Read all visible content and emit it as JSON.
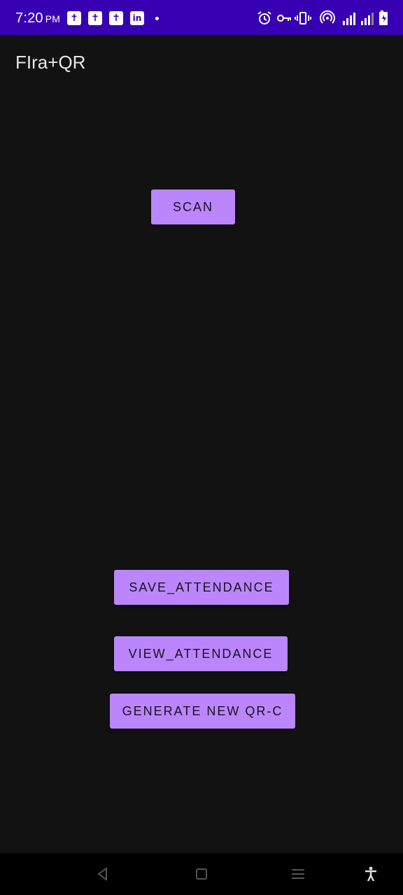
{
  "status_bar": {
    "time": "7:20",
    "ampm": "PM",
    "notification_icons": [
      "bible-app-icon",
      "bible-app-icon",
      "bible-app-icon",
      "linkedin-icon"
    ],
    "system_icons": [
      "alarm-icon",
      "vpn-key-icon",
      "vibrate-icon",
      "hotspot-icon",
      "signal-icon",
      "battery-icon"
    ]
  },
  "app_bar": {
    "title": "FIra+QR"
  },
  "buttons": {
    "scan": "SCAN",
    "save_attendance": "SAVE_ATTENDANCE",
    "view_attendance": "VIEW_ATTENDANCE",
    "generate_qr": "GENERATE NEW QR-C"
  },
  "nav_bar": {
    "items": [
      "back-icon",
      "home-icon",
      "recents-icon",
      "accessibility-icon"
    ]
  },
  "colors": {
    "status_bar": "#3700b3",
    "background": "#121212",
    "button": "#bb86fc",
    "button_text": "#1a1022",
    "nav_bar": "#000000"
  }
}
